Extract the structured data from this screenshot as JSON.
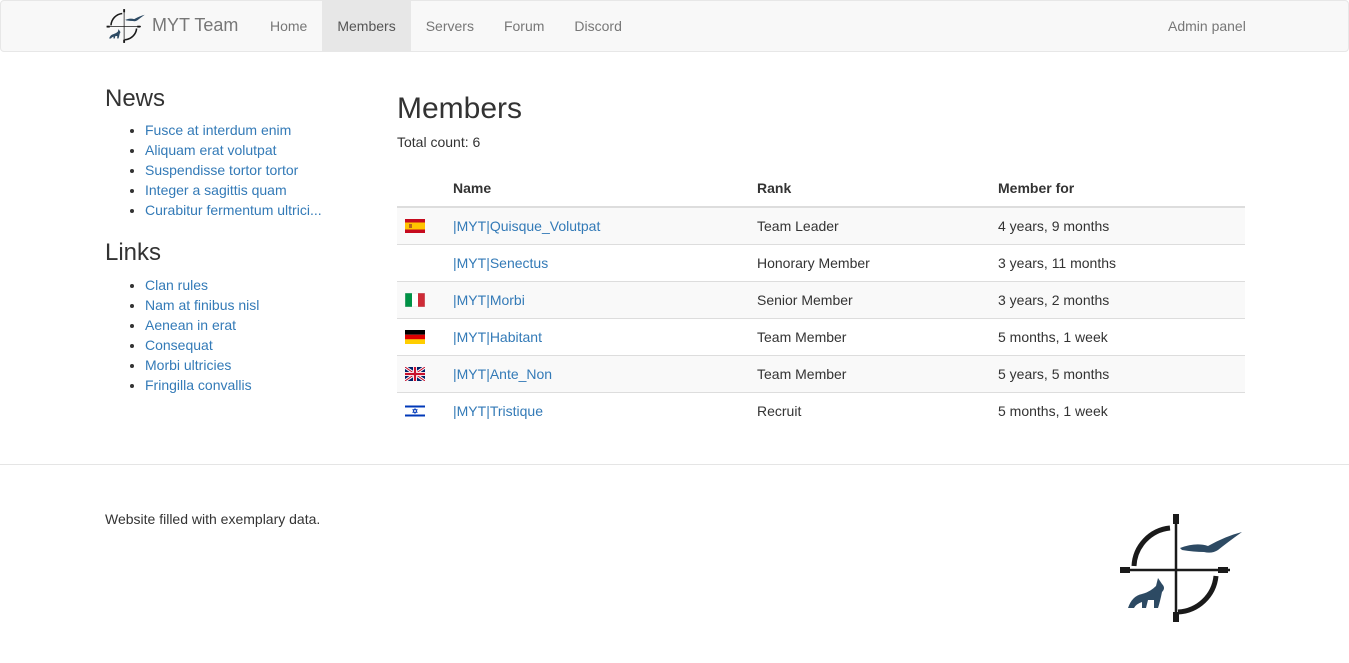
{
  "brand": {
    "name": "MYT Team",
    "logo_icon": "crosshair-eagle-wolf-logo-icon"
  },
  "nav": {
    "items": [
      {
        "label": "Home",
        "active": false
      },
      {
        "label": "Members",
        "active": true
      },
      {
        "label": "Servers",
        "active": false
      },
      {
        "label": "Forum",
        "active": false
      },
      {
        "label": "Discord",
        "active": false
      }
    ],
    "right_label": "Admin panel"
  },
  "sidebar": {
    "news_title": "News",
    "news": [
      "Fusce at interdum enim",
      "Aliquam erat volutpat",
      "Suspendisse tortor tortor",
      "Integer a sagittis quam",
      "Curabitur fermentum ultrici..."
    ],
    "links_title": "Links",
    "links": [
      "Clan rules",
      "Nam at finibus nisl",
      "Aenean in erat",
      "Consequat",
      "Morbi ultricies",
      "Fringilla convallis"
    ]
  },
  "main": {
    "title": "Members",
    "count_label": "Total count: 6",
    "columns": {
      "name": "Name",
      "rank": "Rank",
      "member_for": "Member for"
    },
    "rows": [
      {
        "flag": "es-flag-icon",
        "name": "|MYT|Quisque_Volutpat",
        "rank": "Team Leader",
        "member_for": "4 years, 9 months"
      },
      {
        "flag": "",
        "name": "|MYT|Senectus",
        "rank": "Honorary Member",
        "member_for": "3 years, 11 months"
      },
      {
        "flag": "it-flag-icon",
        "name": "|MYT|Morbi",
        "rank": "Senior Member",
        "member_for": "3 years, 2 months"
      },
      {
        "flag": "de-flag-icon",
        "name": "|MYT|Habitant",
        "rank": "Team Member",
        "member_for": "5 months, 1 week"
      },
      {
        "flag": "gb-flag-icon",
        "name": "|MYT|Ante_Non",
        "rank": "Team Member",
        "member_for": "5 years, 5 months"
      },
      {
        "flag": "il-flag-icon",
        "name": "|MYT|Tristique",
        "rank": "Recruit",
        "member_for": "5 months, 1 week"
      }
    ]
  },
  "footer": {
    "text": "Website filled with exemplary data.",
    "logo_icon": "crosshair-eagle-wolf-logo-icon"
  },
  "colors": {
    "link": "#337ab7",
    "navbar_bg": "#f8f8f8",
    "nav_active_bg": "#e7e7e7",
    "stripe": "#f9f9f9",
    "logo_blue": "#2d4a63"
  }
}
